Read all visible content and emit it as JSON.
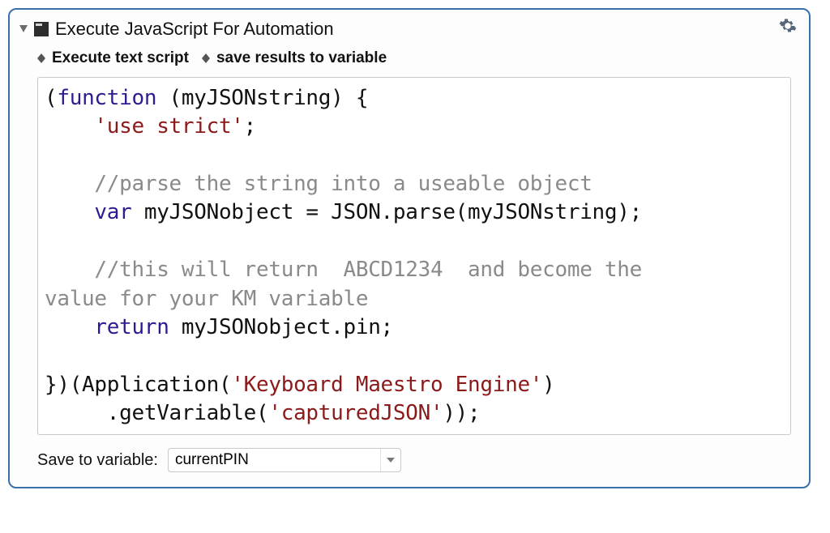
{
  "header": {
    "title": "Execute JavaScript For Automation"
  },
  "options": {
    "mode": "Execute text script",
    "output": "save results to variable"
  },
  "code": {
    "t1": "(",
    "kw_function": "function",
    "t2": " (myJSONstring) {",
    "t3": "    ",
    "str_strict": "'use strict'",
    "t4": ";",
    "cm1": "    //parse the string into a useable object",
    "t5": "    ",
    "kw_var": "var",
    "t6": " myJSONobject = JSON.parse(myJSONstring);",
    "cm2a": "    //this will return  ABCD1234  and become the ",
    "cm2b": "value for your KM variable",
    "t7": "    ",
    "kw_return": "return",
    "t8": " myJSONobject.pin;",
    "t9": "})(Application(",
    "str_app": "'Keyboard Maestro Engine'",
    "t10": ")",
    "t11": "     .getVariable(",
    "str_var": "'capturedJSON'",
    "t12": "));"
  },
  "footer": {
    "label": "Save to variable:",
    "value": "currentPIN"
  }
}
